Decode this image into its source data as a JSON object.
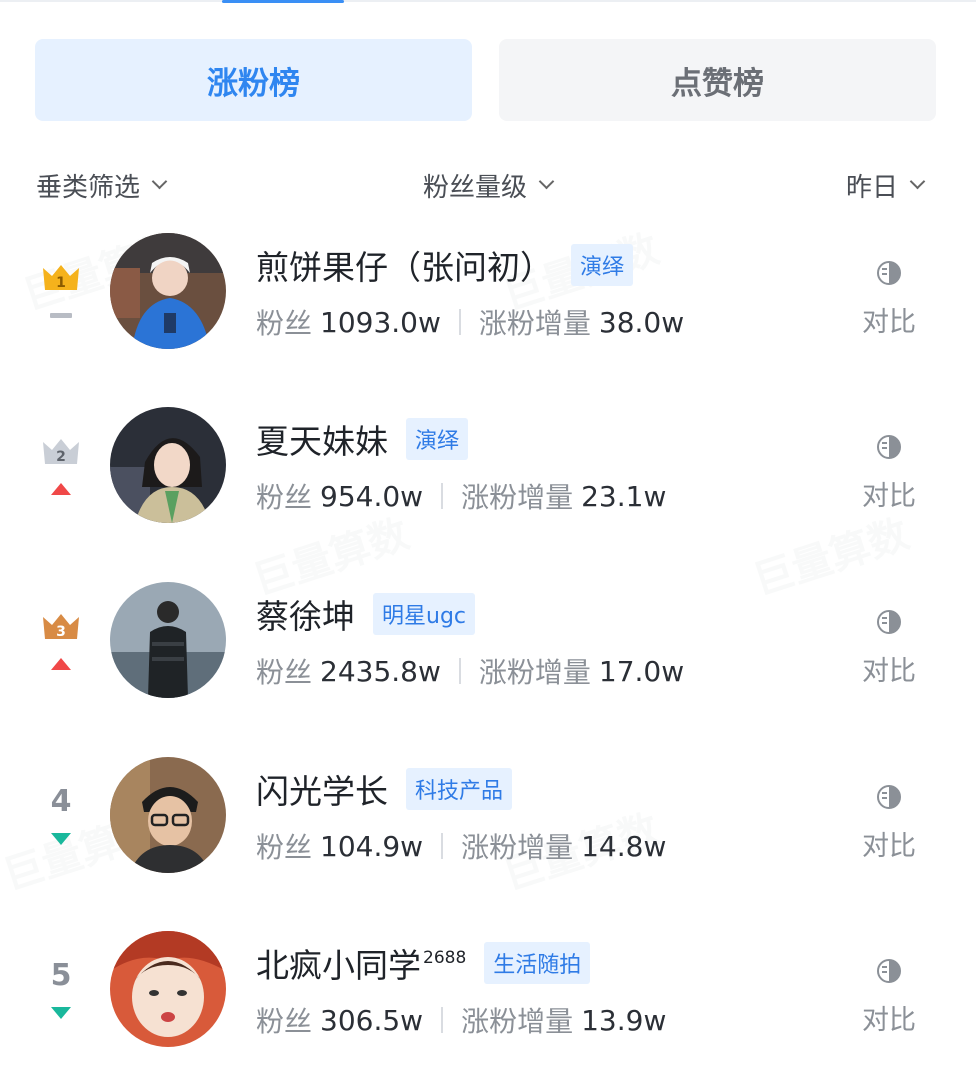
{
  "tabs": [
    {
      "label": "涨粉榜",
      "active": true
    },
    {
      "label": "点赞榜",
      "active": false
    }
  ],
  "filters": {
    "category": "垂类筛选",
    "fan_level": "粉丝量级",
    "date": "昨日"
  },
  "labels": {
    "fans": "粉丝",
    "growth": "涨粉增量",
    "compare": "对比"
  },
  "watermark": "巨量算数",
  "colors": {
    "accent": "#2f86f0",
    "gold": "#f5b21c",
    "silver": "#c9ced6",
    "bronze": "#d88b45",
    "up": "#f04848",
    "down": "#19b89c",
    "flat": "#b8bcc4"
  },
  "items": [
    {
      "rank": "1",
      "rank_style": "crown-gold",
      "trend": "flat",
      "name": "煎饼果仔（张问初）",
      "name_sup": "",
      "tag": "演绎",
      "fans": "1093.0w",
      "growth": "38.0w"
    },
    {
      "rank": "2",
      "rank_style": "crown-silver",
      "trend": "up",
      "name": "夏天妹妹",
      "name_sup": "",
      "tag": "演绎",
      "fans": "954.0w",
      "growth": "23.1w"
    },
    {
      "rank": "3",
      "rank_style": "crown-bronze",
      "trend": "up",
      "name": "蔡徐坤",
      "name_sup": "",
      "tag": "明星ugc",
      "fans": "2435.8w",
      "growth": "17.0w"
    },
    {
      "rank": "4",
      "rank_style": "number",
      "trend": "down",
      "name": "闪光学长",
      "name_sup": "",
      "tag": "科技产品",
      "fans": "104.9w",
      "growth": "14.8w"
    },
    {
      "rank": "5",
      "rank_style": "number",
      "trend": "down",
      "name": "北疯小同学",
      "name_sup": "2688",
      "tag": "生活随拍",
      "fans": "306.5w",
      "growth": "13.9w"
    }
  ]
}
